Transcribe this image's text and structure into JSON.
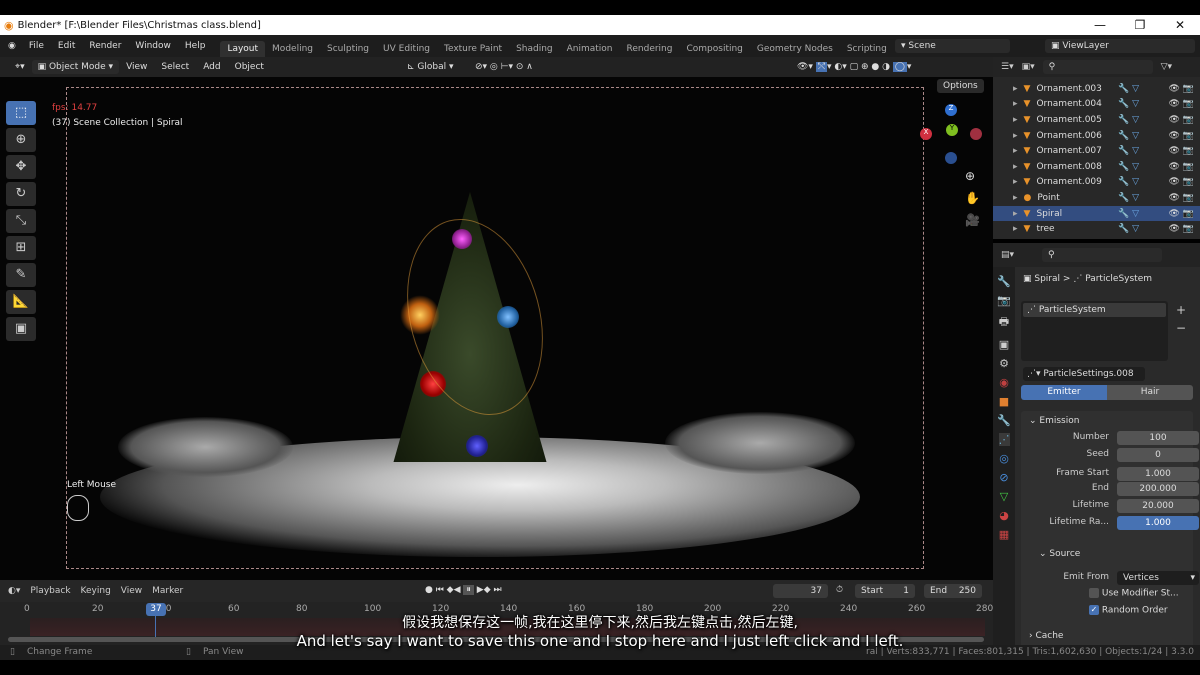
{
  "window": {
    "title": "Blender* [F:\\Blender Files\\Christmas class.blend]",
    "minimize": "—",
    "maximize": "❐",
    "close": "✕"
  },
  "menus": [
    "File",
    "Edit",
    "Render",
    "Window",
    "Help"
  ],
  "workspaces": [
    "Layout",
    "Modeling",
    "Sculpting",
    "UV Editing",
    "Texture Paint",
    "Shading",
    "Animation",
    "Rendering",
    "Compositing",
    "Geometry Nodes",
    "Scripting",
    "+"
  ],
  "active_workspace": "Layout",
  "scene": "Scene",
  "view_layer": "ViewLayer",
  "header3d": {
    "mode": "Object Mode",
    "items": [
      "View",
      "Select",
      "Add",
      "Object"
    ],
    "transform": "Global",
    "options": "Options"
  },
  "viewport": {
    "fps": "fps: 14.77",
    "info": "(37) Scene Collection | Spiral",
    "left_mouse": "Left Mouse"
  },
  "outliner": {
    "rows": [
      {
        "name": "Ornament.003",
        "selected": false
      },
      {
        "name": "Ornament.004",
        "selected": false
      },
      {
        "name": "Ornament.005",
        "selected": false
      },
      {
        "name": "Ornament.006",
        "selected": false
      },
      {
        "name": "Ornament.007",
        "selected": false
      },
      {
        "name": "Ornament.008",
        "selected": false
      },
      {
        "name": "Ornament.009",
        "selected": false
      },
      {
        "name": "Point",
        "selected": false
      },
      {
        "name": "Spiral",
        "selected": true
      },
      {
        "name": "tree",
        "selected": false
      }
    ]
  },
  "properties": {
    "breadcrumb_object": "Spiral",
    "breadcrumb_sep": ">",
    "breadcrumb_data": "ParticleSystem",
    "list_item": "ParticleSystem",
    "settings": "ParticleSettings.008",
    "tabs": [
      "Emitter",
      "Hair"
    ],
    "active_tab": "Emitter",
    "emission": {
      "title": "Emission",
      "fields": [
        {
          "label": "Number",
          "value": "100"
        },
        {
          "label": "Seed",
          "value": "0"
        },
        {
          "label": "Frame Start",
          "value": "1.000"
        },
        {
          "label": "End",
          "value": "200.000"
        },
        {
          "label": "Lifetime",
          "value": "20.000"
        },
        {
          "label": "Lifetime Ra...",
          "value": "1.000",
          "active": true
        }
      ]
    },
    "source": {
      "title": "Source",
      "emit_from_label": "Emit From",
      "emit_from": "Vertices",
      "use_modifier": "Use Modifier St...",
      "use_modifier_checked": false,
      "random_order": "Random Order",
      "random_order_checked": true
    },
    "cache": "Cache"
  },
  "timeline": {
    "menus": [
      "Playback",
      "Keying",
      "View",
      "Marker"
    ],
    "current_frame": "37",
    "start_label": "Start",
    "start": "1",
    "end_label": "End",
    "end": "250",
    "ticks": [
      "0",
      "20",
      "40",
      "60",
      "80",
      "100",
      "120",
      "140",
      "160",
      "180",
      "200",
      "220",
      "240",
      "260",
      "280"
    ]
  },
  "status": {
    "left1": "Change Frame",
    "left2": "Pan View",
    "right": "ral | Verts:833,771 | Faces:801,315 | Tris:1,602,630 | Objects:1/24 | 3.3.0"
  },
  "subtitles": {
    "zh": "假设我想保存这一帧,我在这里停下来,然后我左键点击,然后左键,",
    "en": "And let's say I want to save this one and I stop here and I just left click and I left."
  },
  "colors": {
    "accent": "#4772b3",
    "selected_row": "#334d80",
    "fps_text": "#e04040"
  }
}
